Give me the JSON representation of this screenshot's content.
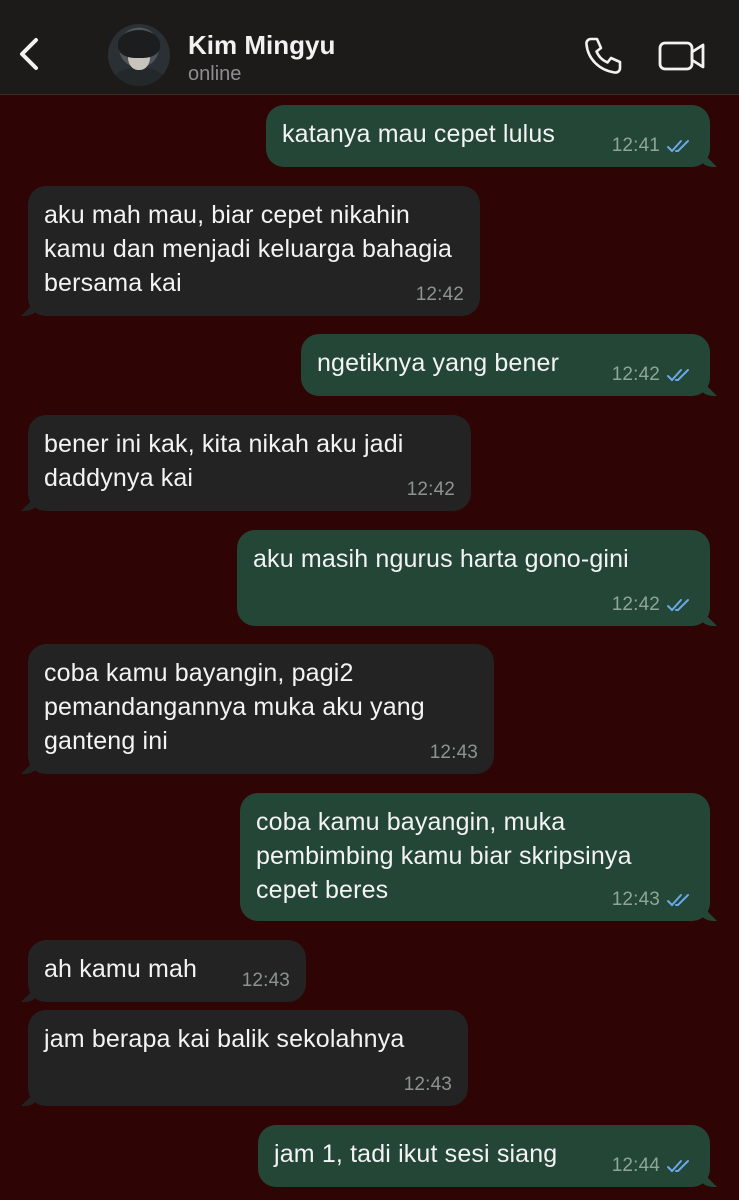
{
  "header": {
    "contact_name": "Kim Mingyu",
    "status": "online",
    "back_icon": "chevron-left-icon",
    "call_icon": "phone-icon",
    "video_icon": "video-camera-icon"
  },
  "colors": {
    "background": "#2e0404",
    "header_bg": "#1d1a1a",
    "incoming_bubble": "#232323",
    "outgoing_bubble": "#234636",
    "read_ticks": "#6aa8e8"
  },
  "messages": [
    {
      "direction": "out",
      "text": "katanya mau cepet lulus",
      "time": "12:41",
      "read": true
    },
    {
      "direction": "in",
      "text": "aku mah mau, biar cepet nikahin kamu dan menjadi keluarga bahagia bersama kai",
      "time": "12:42"
    },
    {
      "direction": "out",
      "text": "ngetiknya yang bener",
      "time": "12:42",
      "read": true
    },
    {
      "direction": "in",
      "text": "bener ini kak, kita nikah aku jadi daddynya kai",
      "time": "12:42"
    },
    {
      "direction": "out",
      "text": "aku masih ngurus harta gono-gini",
      "time": "12:42",
      "read": true
    },
    {
      "direction": "in",
      "text": "coba kamu bayangin, pagi2 pemandangannya muka aku yang ganteng ini",
      "time": "12:43"
    },
    {
      "direction": "out",
      "text": "coba kamu bayangin, muka pembimbing kamu biar skripsinya cepet beres",
      "time": "12:43",
      "read": true
    },
    {
      "direction": "in",
      "text": "ah kamu mah",
      "time": "12:43"
    },
    {
      "direction": "in",
      "text": "jam berapa kai balik sekolahnya",
      "time": "12:43"
    },
    {
      "direction": "out",
      "text": "jam 1, tadi ikut sesi siang",
      "time": "12:44",
      "read": true
    }
  ]
}
